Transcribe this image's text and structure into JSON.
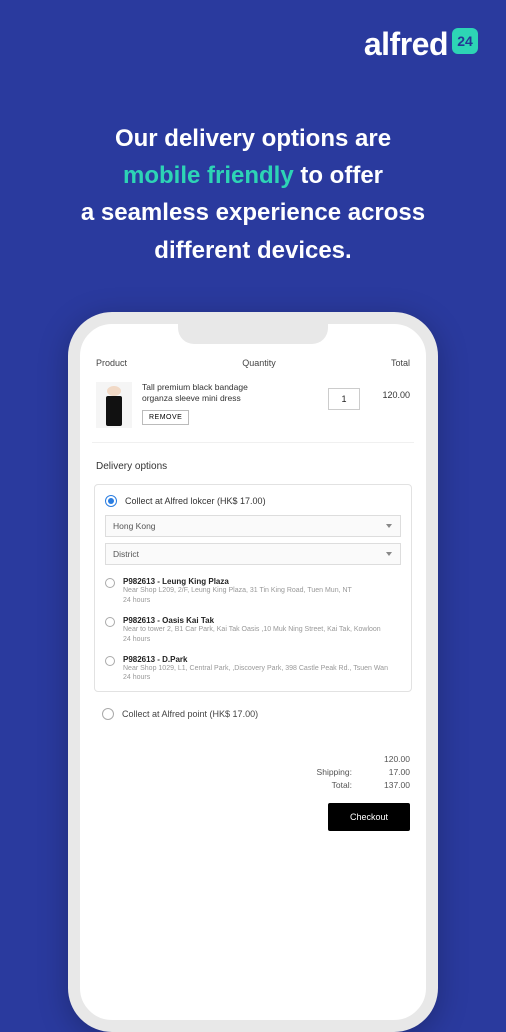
{
  "brand": {
    "name": "alfred",
    "badge": "24"
  },
  "headline": {
    "line1": "Our delivery options are",
    "accent": "mobile friendly",
    "line2_rest": " to offer",
    "line3": "a seamless experience across",
    "line4": "different devices."
  },
  "cart": {
    "headers": {
      "product": "Product",
      "quantity": "Quantity",
      "total": "Total"
    },
    "item": {
      "title": "Tall premium black bandage organza sleeve mini dress",
      "remove_label": "REMOVE",
      "qty": "1",
      "price": "120.00"
    }
  },
  "delivery": {
    "section_title": "Delivery options",
    "locker_option_label": "Collect at Alfred lokcer  (HK$ 17.00)",
    "region_select": "Hong Kong",
    "district_select": "District",
    "locations": [
      {
        "name": "P982613 - Leung King Plaza",
        "addr": "Near Shop L209, 2/F, Leung King Plaza, 31 Tin King Road, Tuen Mun, NT",
        "hours": "24 hours"
      },
      {
        "name": "P982613 - Oasis Kai Tak",
        "addr": "Near to tower 2, B1 Car Park, Kai Tak Oasis ,10 Muk Ning Street, Kai Tak, Kowloon",
        "hours": "24 hours"
      },
      {
        "name": "P982613 - D.Park",
        "addr": "Near Shop 1029, L1, Central Park, ,Discovery Park, 398 Castle Peak Rd., Tsuen Wan",
        "hours": "24 hours"
      }
    ],
    "alt_option_label": "Collect at Alfred point  (HK$ 17.00)"
  },
  "totals": {
    "subtotal": "120.00",
    "shipping_label": "Shipping:",
    "shipping": "17.00",
    "total_label": "Total:",
    "total": "137.00"
  },
  "checkout_label": "Checkout"
}
